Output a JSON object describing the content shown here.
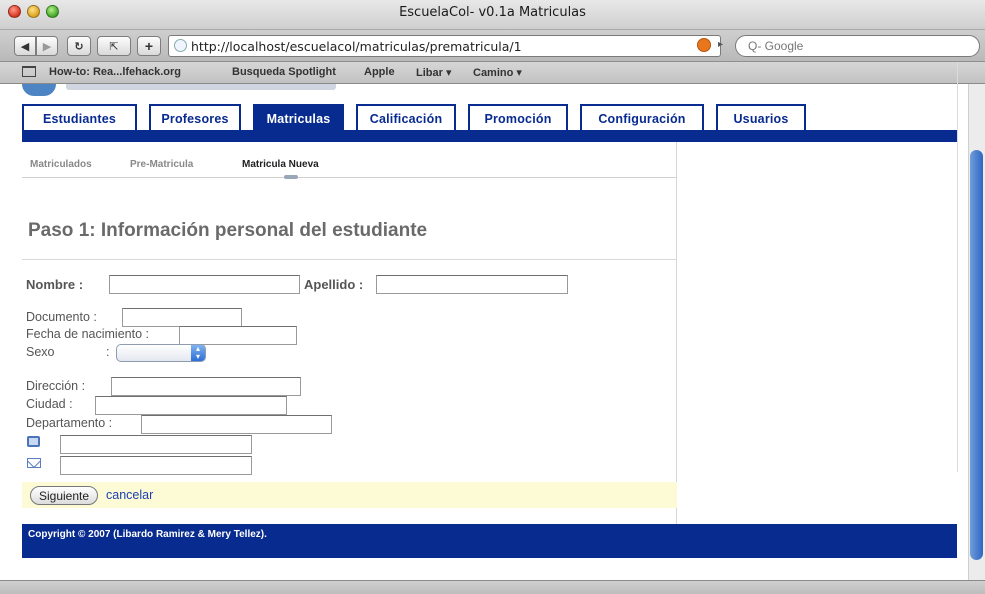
{
  "window": {
    "title": "EscuelaCol- v0.1a Matriculas"
  },
  "toolbar": {
    "url": "http://localhost/escuelacol/matriculas/prematricula/1",
    "search_placeholder": "Q- Google"
  },
  "bookmarks": [
    "How-to: Rea...lfehack.org",
    "Busqueda Spotlight",
    "Apple",
    "Libar ▾",
    "Camino ▾"
  ],
  "tabs": [
    {
      "label": "Estudiantes",
      "active": false
    },
    {
      "label": "Profesores",
      "active": false
    },
    {
      "label": "Matriculas",
      "active": true
    },
    {
      "label": "Calificación",
      "active": false
    },
    {
      "label": "Promoción",
      "active": false
    },
    {
      "label": "Configuración",
      "active": false
    },
    {
      "label": "Usuarios",
      "active": false
    }
  ],
  "subnav": [
    {
      "label": "Matriculados",
      "active": false
    },
    {
      "label": "Pre-Matricula",
      "active": false
    },
    {
      "label": "Matricula Nueva",
      "active": true
    }
  ],
  "form": {
    "heading": "Paso 1: Información personal del estudiante",
    "nombre_label": "Nombre :",
    "apellido_label": "Apellido :",
    "documento_label": "Documento :",
    "fecha_label": "Fecha de nacimiento :",
    "sexo_label": "Sexo",
    "sexo_colon": ":",
    "direccion_label": "Dirección :",
    "ciudad_label": "Ciudad :",
    "departamento_label": "Departamento :",
    "submit_label": "Siguiente",
    "cancel_label": "cancelar"
  },
  "footer": {
    "copyright": "Copyright © 2007 (Libardo Ramirez & Mery Tellez)."
  },
  "colors": {
    "nav_blue": "#082b8f",
    "form_actions_bg": "#fdfbd6"
  }
}
